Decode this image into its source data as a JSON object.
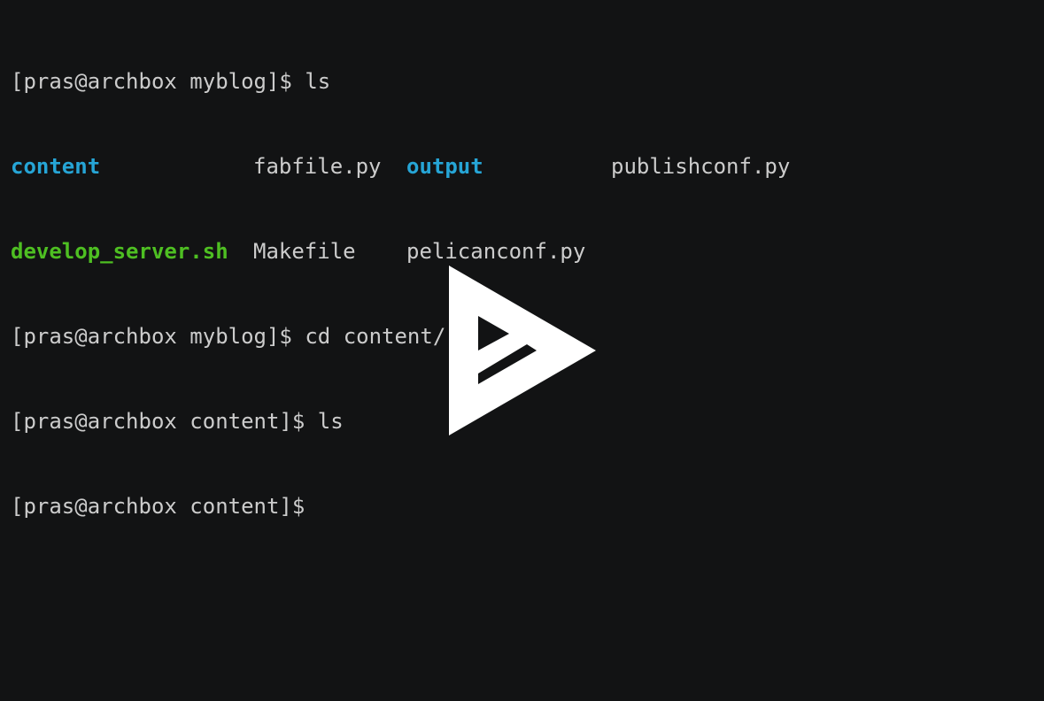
{
  "terminal": {
    "lines": [
      {
        "type": "command",
        "prompt": "[pras@archbox myblog]$",
        "command": " ls"
      },
      {
        "type": "listing",
        "entries": [
          {
            "name": "content",
            "kind": "directory"
          },
          {
            "name": "fabfile.py",
            "kind": "file"
          },
          {
            "name": "output",
            "kind": "directory"
          },
          {
            "name": "publishconf.py",
            "kind": "file"
          }
        ]
      },
      {
        "type": "listing",
        "entries": [
          {
            "name": "develop_server.sh",
            "kind": "executable"
          },
          {
            "name": "Makefile",
            "kind": "file"
          },
          {
            "name": "pelicanconf.py",
            "kind": "file"
          }
        ]
      },
      {
        "type": "command",
        "prompt": "[pras@archbox myblog]$",
        "command": " cd content/"
      },
      {
        "type": "command",
        "prompt": "[pras@archbox content]$",
        "command": " ls"
      },
      {
        "type": "command",
        "prompt": "[pras@archbox content]$",
        "command": ""
      }
    ],
    "colors": {
      "background": "#121314",
      "foreground": "#cccccc",
      "directory": "#26a5d6",
      "executable": "#4ebf22"
    }
  },
  "player": {
    "overlay_icon": "asciinema-play-icon",
    "overlay_color": "#ffffff"
  }
}
